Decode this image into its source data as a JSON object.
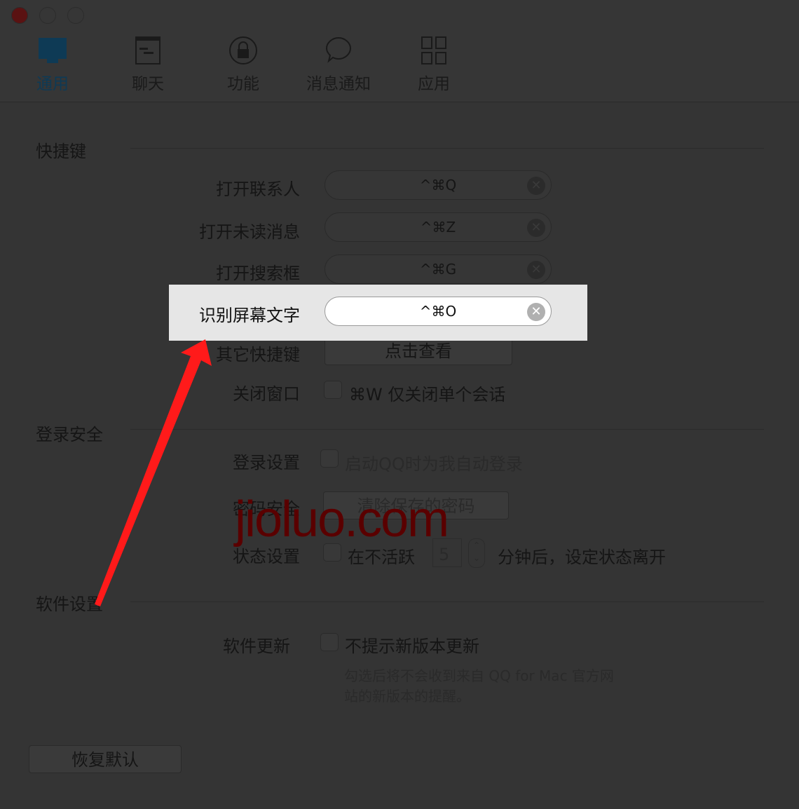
{
  "tabs": [
    {
      "label": "通用",
      "icon": "monitor-icon",
      "active": true
    },
    {
      "label": "聊天",
      "icon": "chat-window-icon"
    },
    {
      "label": "功能",
      "icon": "lock-icon"
    },
    {
      "label": "消息通知",
      "icon": "speech-bubble-icon"
    },
    {
      "label": "应用",
      "icon": "grid-icon"
    }
  ],
  "sections": {
    "shortcuts": "快捷键",
    "login_security": "登录安全",
    "software": "软件设置"
  },
  "shortcuts": [
    {
      "label": "打开联系人",
      "value": "^⌘Q"
    },
    {
      "label": "打开未读消息",
      "value": "^⌘Z"
    },
    {
      "label": "打开搜索框",
      "value": "^⌘G"
    },
    {
      "label": "识别屏幕文字",
      "value": "^⌘O"
    }
  ],
  "other_shortcuts": {
    "label": "其它快捷键",
    "button": "点击查看"
  },
  "close_window": {
    "label": "关闭窗口",
    "option": "⌘W 仅关闭单个会话"
  },
  "login": {
    "label": "登录设置",
    "option": "启动QQ时为我自动登录"
  },
  "password": {
    "label": "密码安全",
    "button": "清除保存的密码"
  },
  "status": {
    "label": "状态设置",
    "prefix": "在不活跃",
    "minutes": "5",
    "suffix": "分钟后，设定状态离开"
  },
  "update": {
    "label": "软件更新",
    "option": "不提示新版本更新",
    "hint1": "勾选后将不会收到来自 QQ for Mac 官方网",
    "hint2": "站的新版本的提醒。"
  },
  "restore_button": "恢复默认",
  "watermark": "jioluo.com",
  "colors": {
    "accent": "#0e3a55",
    "arrow": "#ff1a1a",
    "highlight": "#e6e6e6"
  }
}
